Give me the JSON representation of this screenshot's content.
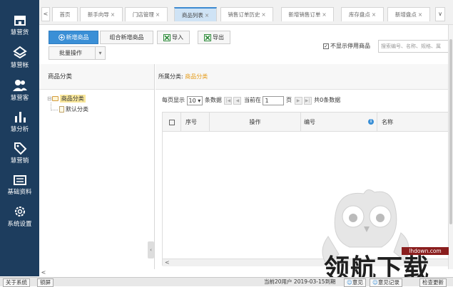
{
  "sidebar": {
    "items": [
      {
        "label": "慧营货",
        "icon": "shop-icon"
      },
      {
        "label": "慧营帐",
        "icon": "ledger-icon"
      },
      {
        "label": "慧营客",
        "icon": "customers-icon"
      },
      {
        "label": "慧分析",
        "icon": "chart-icon"
      },
      {
        "label": "慧营销",
        "icon": "tag-icon"
      },
      {
        "label": "基础资料",
        "icon": "keyboard-icon"
      },
      {
        "label": "系统设置",
        "icon": "gear-icon"
      }
    ],
    "collapse": "<"
  },
  "tabs": {
    "prev": "<",
    "next": "∨",
    "close": "×",
    "items": [
      {
        "label": "首页"
      },
      {
        "label": "新手向导"
      },
      {
        "label": "门店管理"
      },
      {
        "label": "商品列表"
      },
      {
        "label": "销售订单历史"
      },
      {
        "label": "新增销售订单"
      },
      {
        "label": "库存盘点"
      },
      {
        "label": "新增盘点"
      }
    ]
  },
  "toolbar": {
    "new_product": "新增商品",
    "combo_new": "组合新增商品",
    "import": "导入",
    "export": "导出",
    "batch": "批量操作",
    "batch_arrow": "▾",
    "hide_disabled": "不显示停用商品",
    "hide_disabled_check": "✓",
    "search_placeholder": "搜索编号、名称、规格、属"
  },
  "left_panel": {
    "title": "商品分类",
    "tree": [
      {
        "label": "商品分类",
        "selected": true
      },
      {
        "label": "默认分类"
      }
    ],
    "expander": "⊟"
  },
  "right_panel": {
    "breadcrumb_prefix": "所属分类:",
    "breadcrumb_value": "商品分类",
    "pager": {
      "per_page_label": "每页显示",
      "per_page": "10",
      "per_page_unit": "条数据",
      "current_label": "当前在",
      "current_page": "1",
      "page_unit": "页",
      "total": "共0条数据"
    },
    "columns": [
      "序号",
      "操作",
      "编号",
      "名称"
    ],
    "info_icon": "i",
    "scroll_left": "<"
  },
  "statusbar": {
    "about": "关于系统",
    "lock": "锁屏",
    "expiry": "当前20用户 2019-03-15到期",
    "feedback": "意见",
    "feedback_records": "意见记录",
    "check_update": "检查更新"
  },
  "watermark": {
    "text": "领航下载",
    "url": "lhdown.com"
  }
}
